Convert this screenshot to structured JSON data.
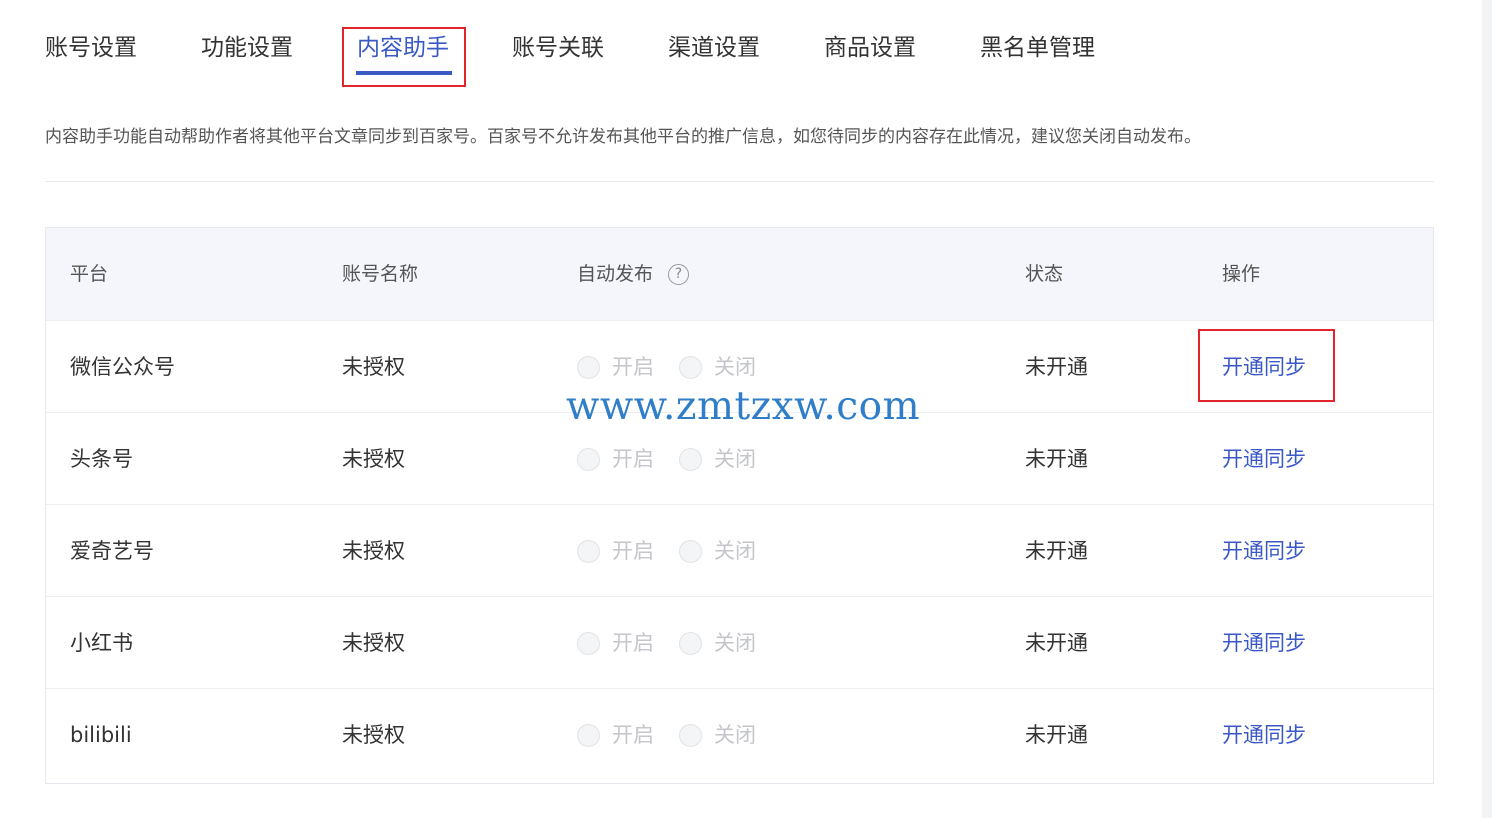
{
  "tabs": [
    {
      "label": "账号设置"
    },
    {
      "label": "功能设置"
    },
    {
      "label": "内容助手"
    },
    {
      "label": "账号关联"
    },
    {
      "label": "渠道设置"
    },
    {
      "label": "商品设置"
    },
    {
      "label": "黑名单管理"
    }
  ],
  "active_tab": "内容助手",
  "description": "内容助手功能自动帮助作者将其他平台文章同步到百家号。百家号不允许发布其他平台的推广信息，如您待同步的内容存在此情况，建议您关闭自动发布。",
  "table": {
    "headers": {
      "platform": "平台",
      "account_name": "账号名称",
      "auto_publish": "自动发布",
      "status": "状态",
      "action": "操作"
    },
    "help_icon_symbol": "?",
    "radio_on_label": "开启",
    "radio_off_label": "关闭",
    "rows": [
      {
        "platform": "微信公众号",
        "account_name": "未授权",
        "status": "未开通",
        "action": "开通同步"
      },
      {
        "platform": "头条号",
        "account_name": "未授权",
        "status": "未开通",
        "action": "开通同步"
      },
      {
        "platform": "爱奇艺号",
        "account_name": "未授权",
        "status": "未开通",
        "action": "开通同步"
      },
      {
        "platform": "小红书",
        "account_name": "未授权",
        "status": "未开通",
        "action": "开通同步"
      },
      {
        "platform": "bilibili",
        "account_name": "未授权",
        "status": "未开通",
        "action": "开通同步"
      }
    ]
  },
  "watermark": "www.zmtzxw.com",
  "colors": {
    "accent": "#3a59c5",
    "highlight_border": "#e4242c",
    "header_background": "#f4f6fb",
    "watermark": "#2f7ec7"
  }
}
